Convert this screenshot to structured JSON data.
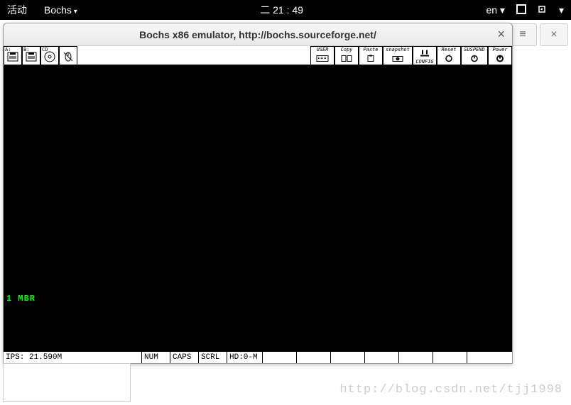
{
  "topbar": {
    "activities": "活动",
    "app": "Bochs",
    "clock_prefix": "二",
    "clock_time": "21 : 49",
    "lang": "en"
  },
  "window": {
    "title": "Bochs x86 emulator, http://bochs.sourceforge.net/",
    "close": "×"
  },
  "toolbar": {
    "drive_a": "A:",
    "drive_b": "B:",
    "drive_cd": "CD",
    "user": "USER",
    "copy": "Copy",
    "paste": "Paste",
    "snapshot": "snapshot",
    "config": "CONFIG",
    "reset": "Reset",
    "suspend": "SUSPEND",
    "power": "Power"
  },
  "console": {
    "line1": "1 MBR"
  },
  "statusbar": {
    "ips": "IPS: 21.590M",
    "num": "NUM",
    "caps": "CAPS",
    "scrl": "SCRL",
    "hd": "HD:0-M"
  },
  "watermark": "http://blog.csdn.net/tjj1998"
}
